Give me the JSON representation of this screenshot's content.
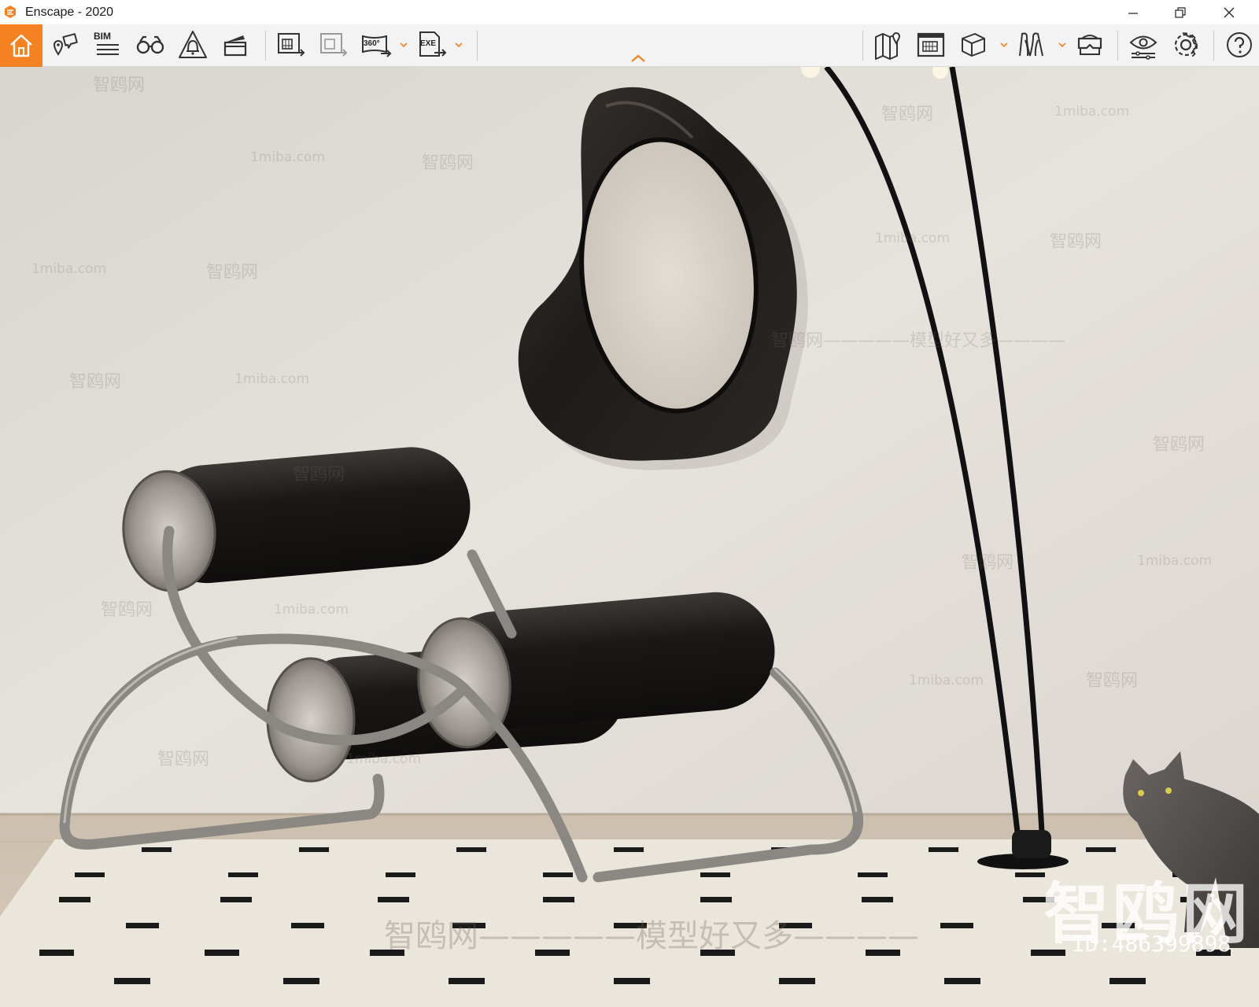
{
  "window": {
    "title": "Enscape - 2020",
    "minimize_label": "minimize",
    "restore_label": "restore",
    "close_label": "close"
  },
  "toolbar": {
    "bim_label": "BIM",
    "panorama_label": "360°",
    "exe_label": "EXE",
    "accent_color": "#f58220"
  },
  "viewport": {
    "watermark_small_cn": "智鸥网",
    "watermark_url": "1miba.com",
    "watermark_slogan": "智鸥网—————模型好又多————",
    "watermark_big": "智鸥网",
    "watermark_id": "ID:486399898",
    "watermark_dashes": "—————"
  }
}
